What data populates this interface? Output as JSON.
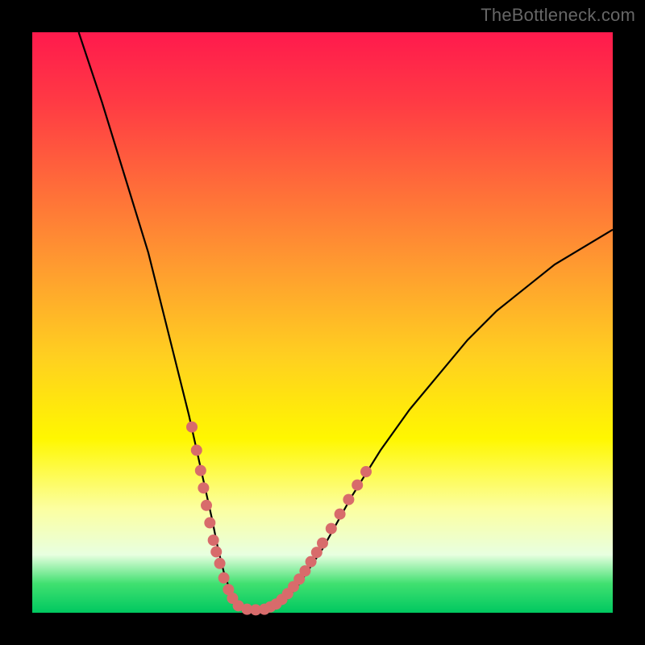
{
  "watermark": "TheBottleneck.com",
  "colors": {
    "background": "#000000",
    "curve": "#000000",
    "dots": "#d86b6b",
    "gradient_top": "#ff1a4d",
    "gradient_bottom": "#00c860"
  },
  "chart_data": {
    "type": "line",
    "title": "",
    "xlabel": "",
    "ylabel": "",
    "xlim": [
      0,
      100
    ],
    "ylim": [
      0,
      100
    ],
    "grid": false,
    "legend": false,
    "series": [
      {
        "name": "curve",
        "x": [
          8,
          12,
          16,
          20,
          23,
          25,
          27,
          29,
          31,
          32,
          33,
          34,
          35,
          36,
          38,
          40,
          42,
          44,
          46,
          50,
          55,
          60,
          65,
          70,
          75,
          80,
          85,
          90,
          95,
          100
        ],
        "y": [
          100,
          88,
          75,
          62,
          50,
          42,
          34,
          25,
          16,
          11,
          7,
          4,
          2,
          1,
          0.5,
          0.5,
          1,
          2.5,
          5,
          11,
          20,
          28,
          35,
          41,
          47,
          52,
          56,
          60,
          63,
          66
        ]
      }
    ],
    "dots": [
      {
        "x": 27.5,
        "y": 32
      },
      {
        "x": 28.3,
        "y": 28
      },
      {
        "x": 29.0,
        "y": 24.5
      },
      {
        "x": 29.5,
        "y": 21.5
      },
      {
        "x": 30.0,
        "y": 18.5
      },
      {
        "x": 30.6,
        "y": 15.5
      },
      {
        "x": 31.2,
        "y": 12.5
      },
      {
        "x": 31.7,
        "y": 10.5
      },
      {
        "x": 32.3,
        "y": 8.5
      },
      {
        "x": 33.0,
        "y": 6.0
      },
      {
        "x": 33.8,
        "y": 4.0
      },
      {
        "x": 34.5,
        "y": 2.5
      },
      {
        "x": 35.5,
        "y": 1.2
      },
      {
        "x": 37.0,
        "y": 0.6
      },
      {
        "x": 38.5,
        "y": 0.5
      },
      {
        "x": 40.0,
        "y": 0.6
      },
      {
        "x": 41.0,
        "y": 1.0
      },
      {
        "x": 42.0,
        "y": 1.5
      },
      {
        "x": 43.0,
        "y": 2.3
      },
      {
        "x": 44.0,
        "y": 3.3
      },
      {
        "x": 45.0,
        "y": 4.5
      },
      {
        "x": 46.0,
        "y": 5.8
      },
      {
        "x": 47.0,
        "y": 7.2
      },
      {
        "x": 48.0,
        "y": 8.8
      },
      {
        "x": 49.0,
        "y": 10.4
      },
      {
        "x": 50.0,
        "y": 12.0
      },
      {
        "x": 51.5,
        "y": 14.5
      },
      {
        "x": 53.0,
        "y": 17.0
      },
      {
        "x": 54.5,
        "y": 19.5
      },
      {
        "x": 56.0,
        "y": 22.0
      },
      {
        "x": 57.5,
        "y": 24.3
      }
    ]
  }
}
